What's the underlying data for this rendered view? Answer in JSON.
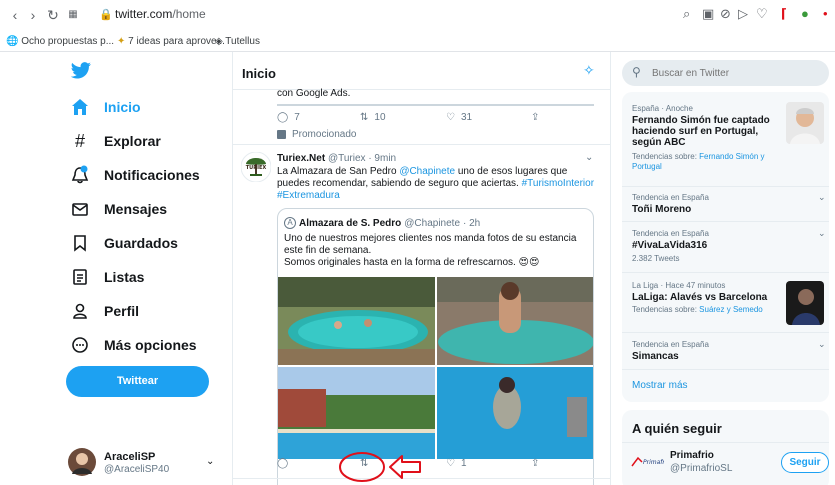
{
  "browser": {
    "url_host": "twitter.com",
    "url_path": "/home",
    "bookmarks": [
      "Ocho propuestas p...",
      "7 ideas para aprove...",
      "Tutellus"
    ]
  },
  "sidebar": {
    "items": [
      {
        "label": "Inicio",
        "icon": "home-icon"
      },
      {
        "label": "Explorar",
        "icon": "hashtag-icon"
      },
      {
        "label": "Notificaciones",
        "icon": "bell-icon"
      },
      {
        "label": "Mensajes",
        "icon": "envelope-icon"
      },
      {
        "label": "Guardados",
        "icon": "bookmark-icon"
      },
      {
        "label": "Listas",
        "icon": "list-icon"
      },
      {
        "label": "Perfil",
        "icon": "person-icon"
      },
      {
        "label": "Más opciones",
        "icon": "more-icon"
      }
    ],
    "tweet_button": "Twittear",
    "account": {
      "name": "AraceliSP",
      "handle": "@AraceliSP40"
    }
  },
  "timeline": {
    "header": "Inicio",
    "prev_tweet": {
      "tail_text": "con Google Ads.",
      "replies": "7",
      "retweets": "10",
      "likes": "31",
      "promoted": "Promocionado"
    },
    "tweet": {
      "name": "Turiex.Net",
      "handle": "@Turiex",
      "time": "· 9min",
      "text_before": "La Almazara de San Pedro ",
      "mention": "@Chapinete",
      "text_after": " uno de esos lugares que puedes recomendar, sabiendo de seguro que aciertas. ",
      "hashtag1": "#TurismoInterior",
      "hashtag2": "#Extremadura",
      "quote": {
        "name": "Almazara de S. Pedro",
        "handle": "@Chapinete",
        "time": "· 2h",
        "line1": "Uno de nuestros mejores clientes nos manda fotos de su estancia este fin de semana.",
        "line2": "Somos originales hasta en la forma de refrescarnos. 😍😍"
      },
      "likes": "1"
    }
  },
  "right": {
    "search_placeholder": "Buscar en Twitter",
    "trends": [
      {
        "meta": "España · Anoche",
        "title": "Fernando Simón fue captado haciendo surf en Portugal, según ABC",
        "sub_prefix": "Tendencias sobre: ",
        "sub_link": "Fernando Simón y Portugal"
      },
      {
        "meta": "Tendencia en España",
        "title": "Toñi Moreno"
      },
      {
        "meta": "Tendencia en España",
        "title": "#VivaLaVida316",
        "count": "2.382 Tweets"
      },
      {
        "meta": "La Liga · Hace 47 minutos",
        "title": "LaLiga: Alavés vs Barcelona",
        "sub_prefix": "Tendencias sobre: ",
        "sub_link": "Suárez y Semedo"
      },
      {
        "meta": "Tendencia en España",
        "title": "Simancas"
      }
    ],
    "show_more": "Mostrar más",
    "who_to_follow": "A quién seguir",
    "suggestion": {
      "name": "Primafrio",
      "handle": "@PrimafrioSL",
      "follow": "Seguir"
    }
  },
  "colors": {
    "accent": "#1da1f2",
    "annotation": "#e0101a"
  }
}
